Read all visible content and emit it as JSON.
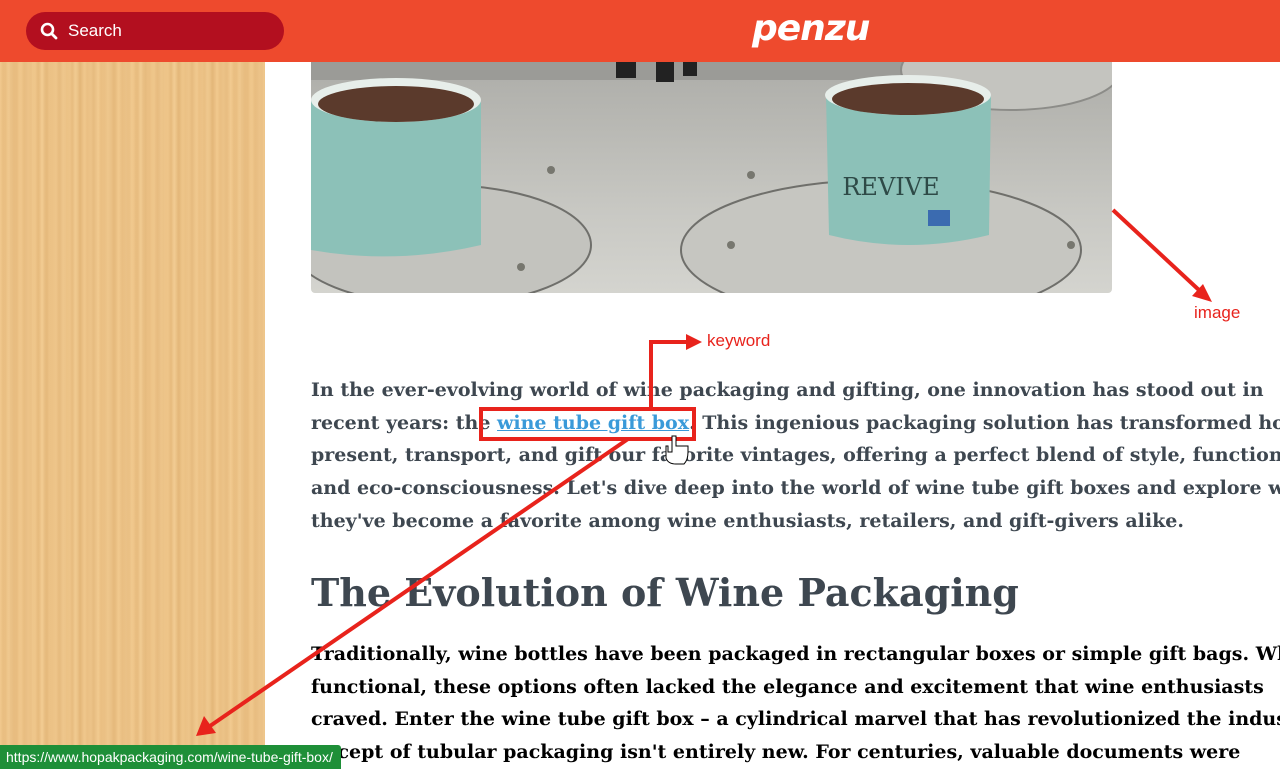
{
  "header": {
    "search_label": "Search",
    "logo_text": "penzu",
    "bar_color": "#ee4a2d",
    "search_bg_color": "#b30f1f"
  },
  "photo": {
    "tube_right_text": "REVIVE"
  },
  "annotations": {
    "keyword_label": "keyword",
    "image_label": "image",
    "color": "#e8231c"
  },
  "article": {
    "intro": {
      "line1": "In the ever-evolving world of wine packaging and gifting, one innovation has stood out in",
      "line2_before": "recent years: the ",
      "keyword_link": "wine tube gift box",
      "line2_after": ". This ingenious packaging solution has transformed how w",
      "line3": "present, transport, and gift our favorite vintages, offering a perfect blend of style, functionalit",
      "line4": "and eco-consciousness. Let's dive deep into the world of wine tube gift boxes and explore why",
      "line5": "they've become a favorite among wine enthusiasts, retailers, and gift-givers alike."
    },
    "heading": "The Evolution of Wine Packaging",
    "para2": {
      "line1": "Traditionally, wine bottles have been packaged in rectangular boxes or simple gift bags. While",
      "line2": "functional, these options often lacked the elegance and excitement that wine enthusiasts",
      "line3": "craved. Enter the wine tube gift box – a cylindrical marvel that has revolutionized the industry",
      "line4": "oncept of tubular packaging isn't entirely new. For centuries, valuable documents were"
    }
  },
  "status_bar": {
    "url": "https://www.hopakpackaging.com/wine-tube-gift-box/",
    "color": "#1e8f38"
  }
}
